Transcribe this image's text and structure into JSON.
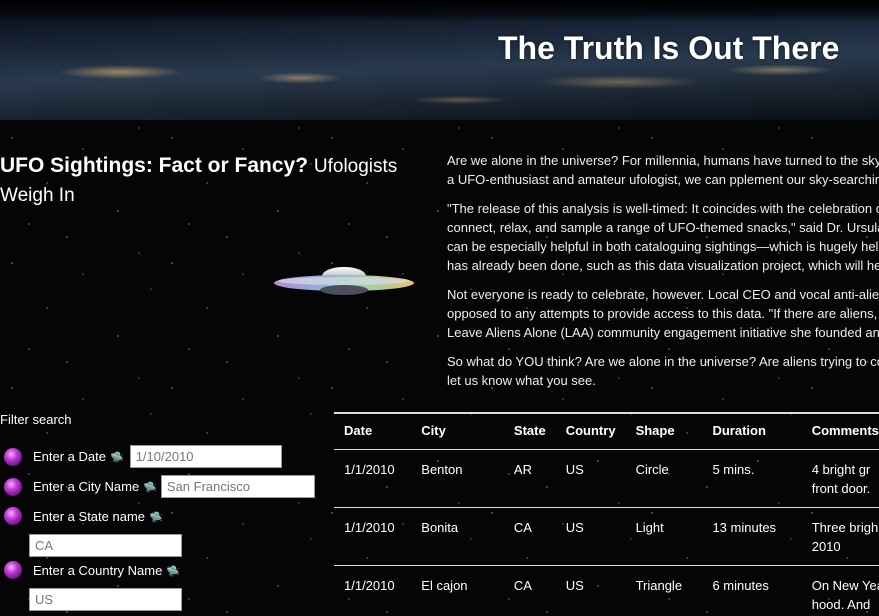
{
  "header": {
    "title": "The Truth Is Out There"
  },
  "article": {
    "heading_bold": "UFO Sightings: Fact or Fancy?",
    "heading_sub": "Ufologists Weigh In",
    "paragraphs": [
      {
        "lines": [
          "Are we alone in the universe? For millennia, humans have turned to the sky to",
          "a UFO-enthusiast and amateur ufologist, we can pplement our sky-searching"
        ]
      },
      {
        "lines": [
          "\"The release of this analysis is well-timed: It coincides with the celebration of",
          "connect, relax, and sample a range of UFO-themed snacks,\" said Dr. Ursula F.",
          "can be especially helpful in both cataloguing sightings—which is hugely help",
          "has already been done, such as this data visualization project, which will help"
        ]
      },
      {
        "lines": [
          "Not everyone is ready to celebrate, however. Local CEO and vocal anti-alien a",
          "opposed to any attempts to provide access to this data. \"If there are aliens, t",
          "Leave Aliens Alone (LAA) community engagement initiative she founded and"
        ]
      },
      {
        "lines": [
          "So what do YOU think? Are we alone in the universe? Are aliens trying to con",
          "let us know what you see."
        ]
      }
    ]
  },
  "filter": {
    "title": "Filter search",
    "fields": [
      {
        "label": "Enter a Date",
        "value": "1/10/2010",
        "icon": "flying-saucer-icon"
      },
      {
        "label": "Enter a City Name",
        "value": "San Francisco",
        "icon": "flying-saucer-icon"
      },
      {
        "label": "Enter a State name",
        "value": "CA",
        "icon": "flying-saucer-icon"
      },
      {
        "label": "Enter a Country Name",
        "value": "US",
        "icon": "flying-saucer-icon"
      }
    ],
    "bullet_icon": "purple-orb-icon"
  },
  "table": {
    "headers": [
      "Date",
      "City",
      "State",
      "Country",
      "Shape",
      "Duration",
      "Comments"
    ],
    "rows": [
      {
        "date": "1/1/2010",
        "city": "Benton",
        "state": "AR",
        "country": "US",
        "shape": "Circle",
        "duration": "5 mins.",
        "comment_1": "4 bright gr",
        "comment_2": "front door."
      },
      {
        "date": "1/1/2010",
        "city": "Bonita",
        "state": "CA",
        "country": "US",
        "shape": "Light",
        "duration": "13 minutes",
        "comment_1": "Three brigh",
        "comment_2": "2010"
      },
      {
        "date": "1/1/2010",
        "city": "El cajon",
        "state": "CA",
        "country": "US",
        "shape": "Triangle",
        "duration": "6 minutes",
        "comment_1": "On New Yea",
        "comment_2": "hood. And"
      }
    ]
  },
  "colors": {
    "background": "#000000",
    "orb": "#c13ad8",
    "text": "#ffffff"
  }
}
